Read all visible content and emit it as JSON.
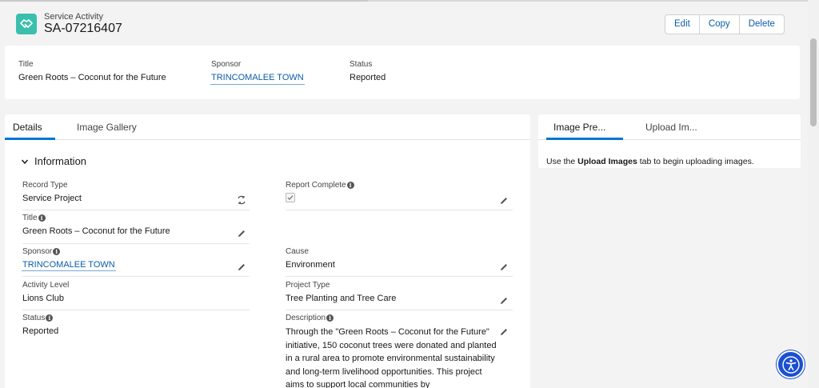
{
  "header": {
    "object_label": "Service Activity",
    "record_name": "SA-07216407",
    "icon": "handshake-icon",
    "icon_color": "#3bbfad",
    "actions": [
      "Edit",
      "Copy",
      "Delete"
    ]
  },
  "highlights": {
    "title_label": "Title",
    "title_value": "Green Roots – Coconut for the Future",
    "sponsor_label": "Sponsor",
    "sponsor_value": "TRINCOMALEE TOWN",
    "status_label": "Status",
    "status_value": "Reported"
  },
  "tabs": {
    "details": "Details",
    "gallery": "Image Gallery"
  },
  "section": {
    "title": "Information"
  },
  "fields": {
    "record_type_label": "Record Type",
    "record_type_value": "Service Project",
    "report_complete_label": "Report Complete",
    "report_complete_checked": true,
    "title_label": "Title",
    "title_value": "Green Roots – Coconut for the Future",
    "sponsor_label": "Sponsor",
    "sponsor_value": "TRINCOMALEE TOWN",
    "cause_label": "Cause",
    "cause_value": "Environment",
    "activity_level_label": "Activity Level",
    "activity_level_value": "Lions Club",
    "project_type_label": "Project Type",
    "project_type_value": "Tree Planting and Tree Care",
    "status_label": "Status",
    "status_value": "Reported",
    "description_label": "Description",
    "description_value": "Through the \"Green Roots – Coconut for the Future\" initiative, 150 coconut trees were donated and planted in a rural area to promote environmental sustainability and long-term livelihood opportunities. This project aims to support local communities by"
  },
  "side": {
    "tab_preview": "Image Pre...",
    "tab_upload": "Upload Im...",
    "msg_pre": "Use the ",
    "msg_bold": "Upload Images",
    "msg_post": " tab to begin uploading images."
  },
  "colors": {
    "accent": "#0176d3",
    "link": "#0b5cab"
  }
}
